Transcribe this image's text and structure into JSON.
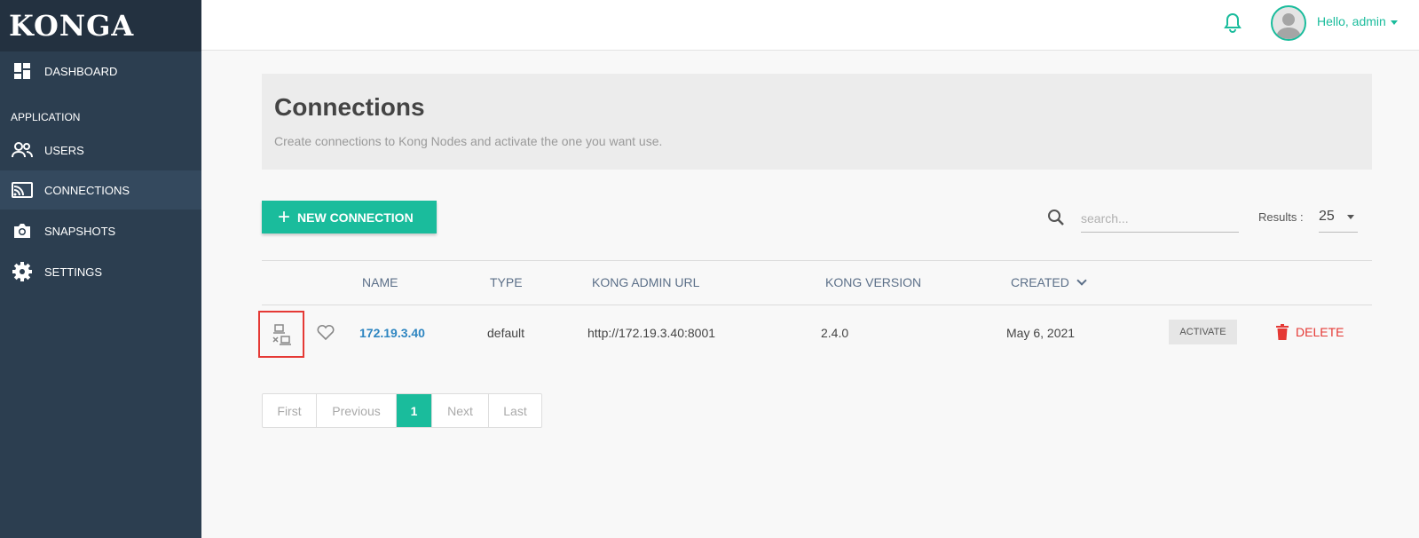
{
  "app": {
    "logo": "KONGA"
  },
  "sidebar": {
    "items": [
      {
        "label": "DASHBOARD",
        "icon": "dashboard-icon"
      },
      {
        "label": "USERS",
        "icon": "users-icon"
      },
      {
        "label": "CONNECTIONS",
        "icon": "connections-icon",
        "active": true
      },
      {
        "label": "SNAPSHOTS",
        "icon": "camera-icon"
      },
      {
        "label": "SETTINGS",
        "icon": "gear-icon"
      }
    ],
    "section": "APPLICATION"
  },
  "topbar": {
    "greeting": "Hello, admin",
    "bell_icon": "bell-icon",
    "avatar_icon": "user-avatar-icon"
  },
  "page": {
    "title": "Connections",
    "subtitle": "Create connections to Kong Nodes and activate the one you want use."
  },
  "toolbar": {
    "new_button": "NEW CONNECTION",
    "search_placeholder": "search...",
    "results_label": "Results :",
    "results_value": "25"
  },
  "table": {
    "headers": {
      "name": "NAME",
      "type": "TYPE",
      "url": "KONG ADMIN URL",
      "version": "KONG VERSION",
      "created": "CREATED"
    },
    "rows": [
      {
        "name": "172.19.3.40",
        "type": "default",
        "url": "http://172.19.3.40:8001",
        "version": "2.4.0",
        "created": "May 6, 2021",
        "activate_label": "ACTIVATE",
        "delete_label": "DELETE"
      }
    ]
  },
  "pagination": {
    "first": "First",
    "previous": "Previous",
    "current": "1",
    "next": "Next",
    "last": "Last"
  },
  "colors": {
    "accent": "#1abc9c",
    "sidebar": "#2c3e50",
    "danger": "#e53935",
    "link": "#2e86c1"
  }
}
